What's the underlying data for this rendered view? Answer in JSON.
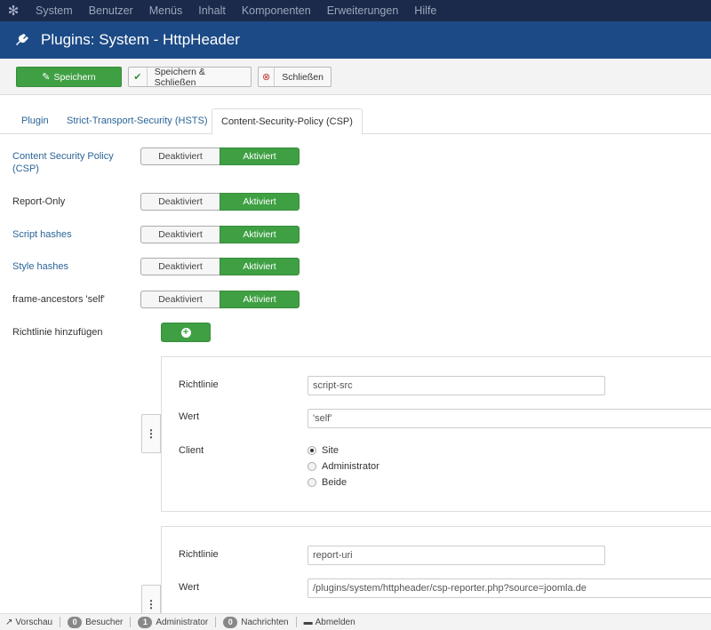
{
  "topnav": {
    "logo_icon": "joomla-logo-icon",
    "items": [
      "System",
      "Benutzer",
      "Menüs",
      "Inhalt",
      "Komponenten",
      "Erweiterungen",
      "Hilfe"
    ]
  },
  "header": {
    "icon": "plug-icon",
    "title": "Plugins: System - HttpHeader"
  },
  "toolbar": {
    "save_label": "Speichern",
    "save_close_label": "Speichern & Schließen",
    "close_label": "Schließen"
  },
  "tabs": [
    "Plugin",
    "Strict-Transport-Security (HSTS)",
    "Content-Security-Policy (CSP)"
  ],
  "active_tab": "Content-Security-Policy (CSP)",
  "toggle_labels": {
    "off": "Deaktiviert",
    "on": "Aktiviert"
  },
  "settings": [
    {
      "label": "Content Security Policy (CSP)",
      "value": "Aktiviert"
    },
    {
      "label": "Report-Only",
      "value": "Aktiviert"
    },
    {
      "label": "Script hashes",
      "value": "Aktiviert"
    },
    {
      "label": "Style hashes",
      "value": "Aktiviert"
    },
    {
      "label": "frame-ancestors 'self'",
      "value": "Aktiviert"
    }
  ],
  "add_directive_label": "Richtlinie hinzufügen",
  "field_labels": {
    "directive": "Richtlinie",
    "value": "Wert",
    "client": "Client"
  },
  "client_options": [
    "Site",
    "Administrator",
    "Beide"
  ],
  "directives": [
    {
      "directive": "script-src",
      "value": "'self'",
      "client": "Site"
    },
    {
      "directive": "report-uri",
      "value": "/plugins/system/httpheader/csp-reporter.php?source=joomla.de"
    }
  ],
  "statusbar": {
    "preview": "Vorschau",
    "visitors_count": "0",
    "visitors_label": "Besucher",
    "admin_count": "1",
    "admin_label": "Administrator",
    "messages_count": "0",
    "messages_label": "Nachrichten",
    "logout": "Abmelden"
  },
  "colors": {
    "topnav": "#1b2a4a",
    "header": "#1c4a86",
    "success": "#3fa043",
    "link": "#2a6496"
  }
}
